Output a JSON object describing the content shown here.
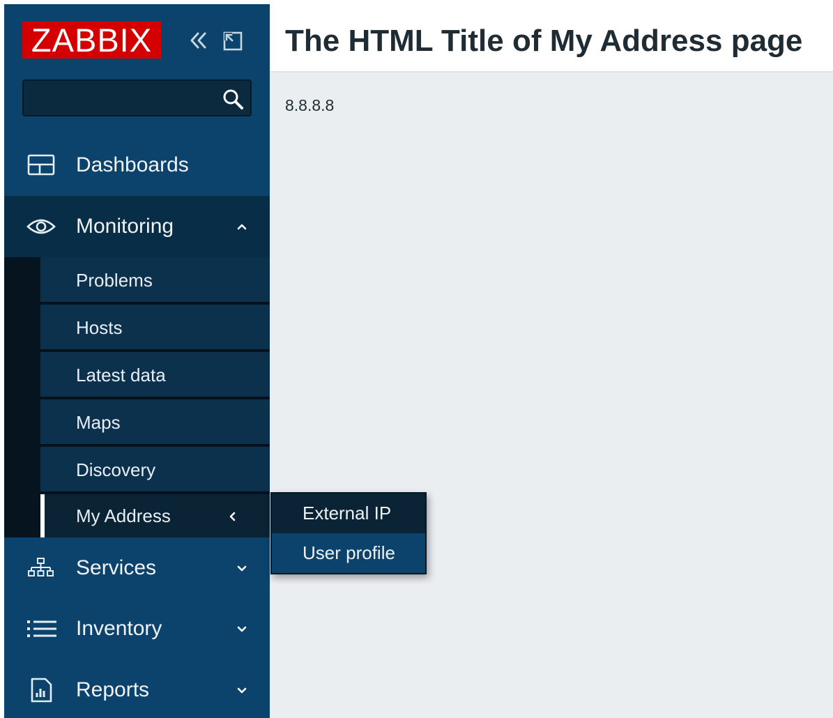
{
  "sidebar": {
    "logo": "ZABBIX",
    "search": {
      "value": "",
      "placeholder": ""
    },
    "menu": {
      "dashboards": "Dashboards",
      "monitoring": "Monitoring",
      "services": "Services",
      "inventory": "Inventory",
      "reports": "Reports"
    },
    "monitoring_submenu": {
      "problems": "Problems",
      "hosts": "Hosts",
      "latest_data": "Latest data",
      "maps": "Maps",
      "discovery": "Discovery",
      "my_address": "My Address"
    },
    "icons": {
      "collapse": "double-chevron-left-icon",
      "kiosk": "kiosk-mode-icon",
      "search": "search-icon",
      "dashboards": "dashboard-icon",
      "monitoring": "eye-icon",
      "services": "hierarchy-icon",
      "inventory": "list-icon",
      "reports": "report-icon"
    }
  },
  "flyout": {
    "external_ip": "External IP",
    "user_profile": "User profile"
  },
  "main": {
    "page_title": "The HTML Title of My Address page",
    "ip_address": "8.8.8.8"
  },
  "colors": {
    "sidebar_bg": "#0b436c",
    "sidebar_expanded_bg": "#082e47",
    "submenu_bg": "#0c314d",
    "logo_bg": "#d40000",
    "content_bg": "#ebeef1"
  }
}
